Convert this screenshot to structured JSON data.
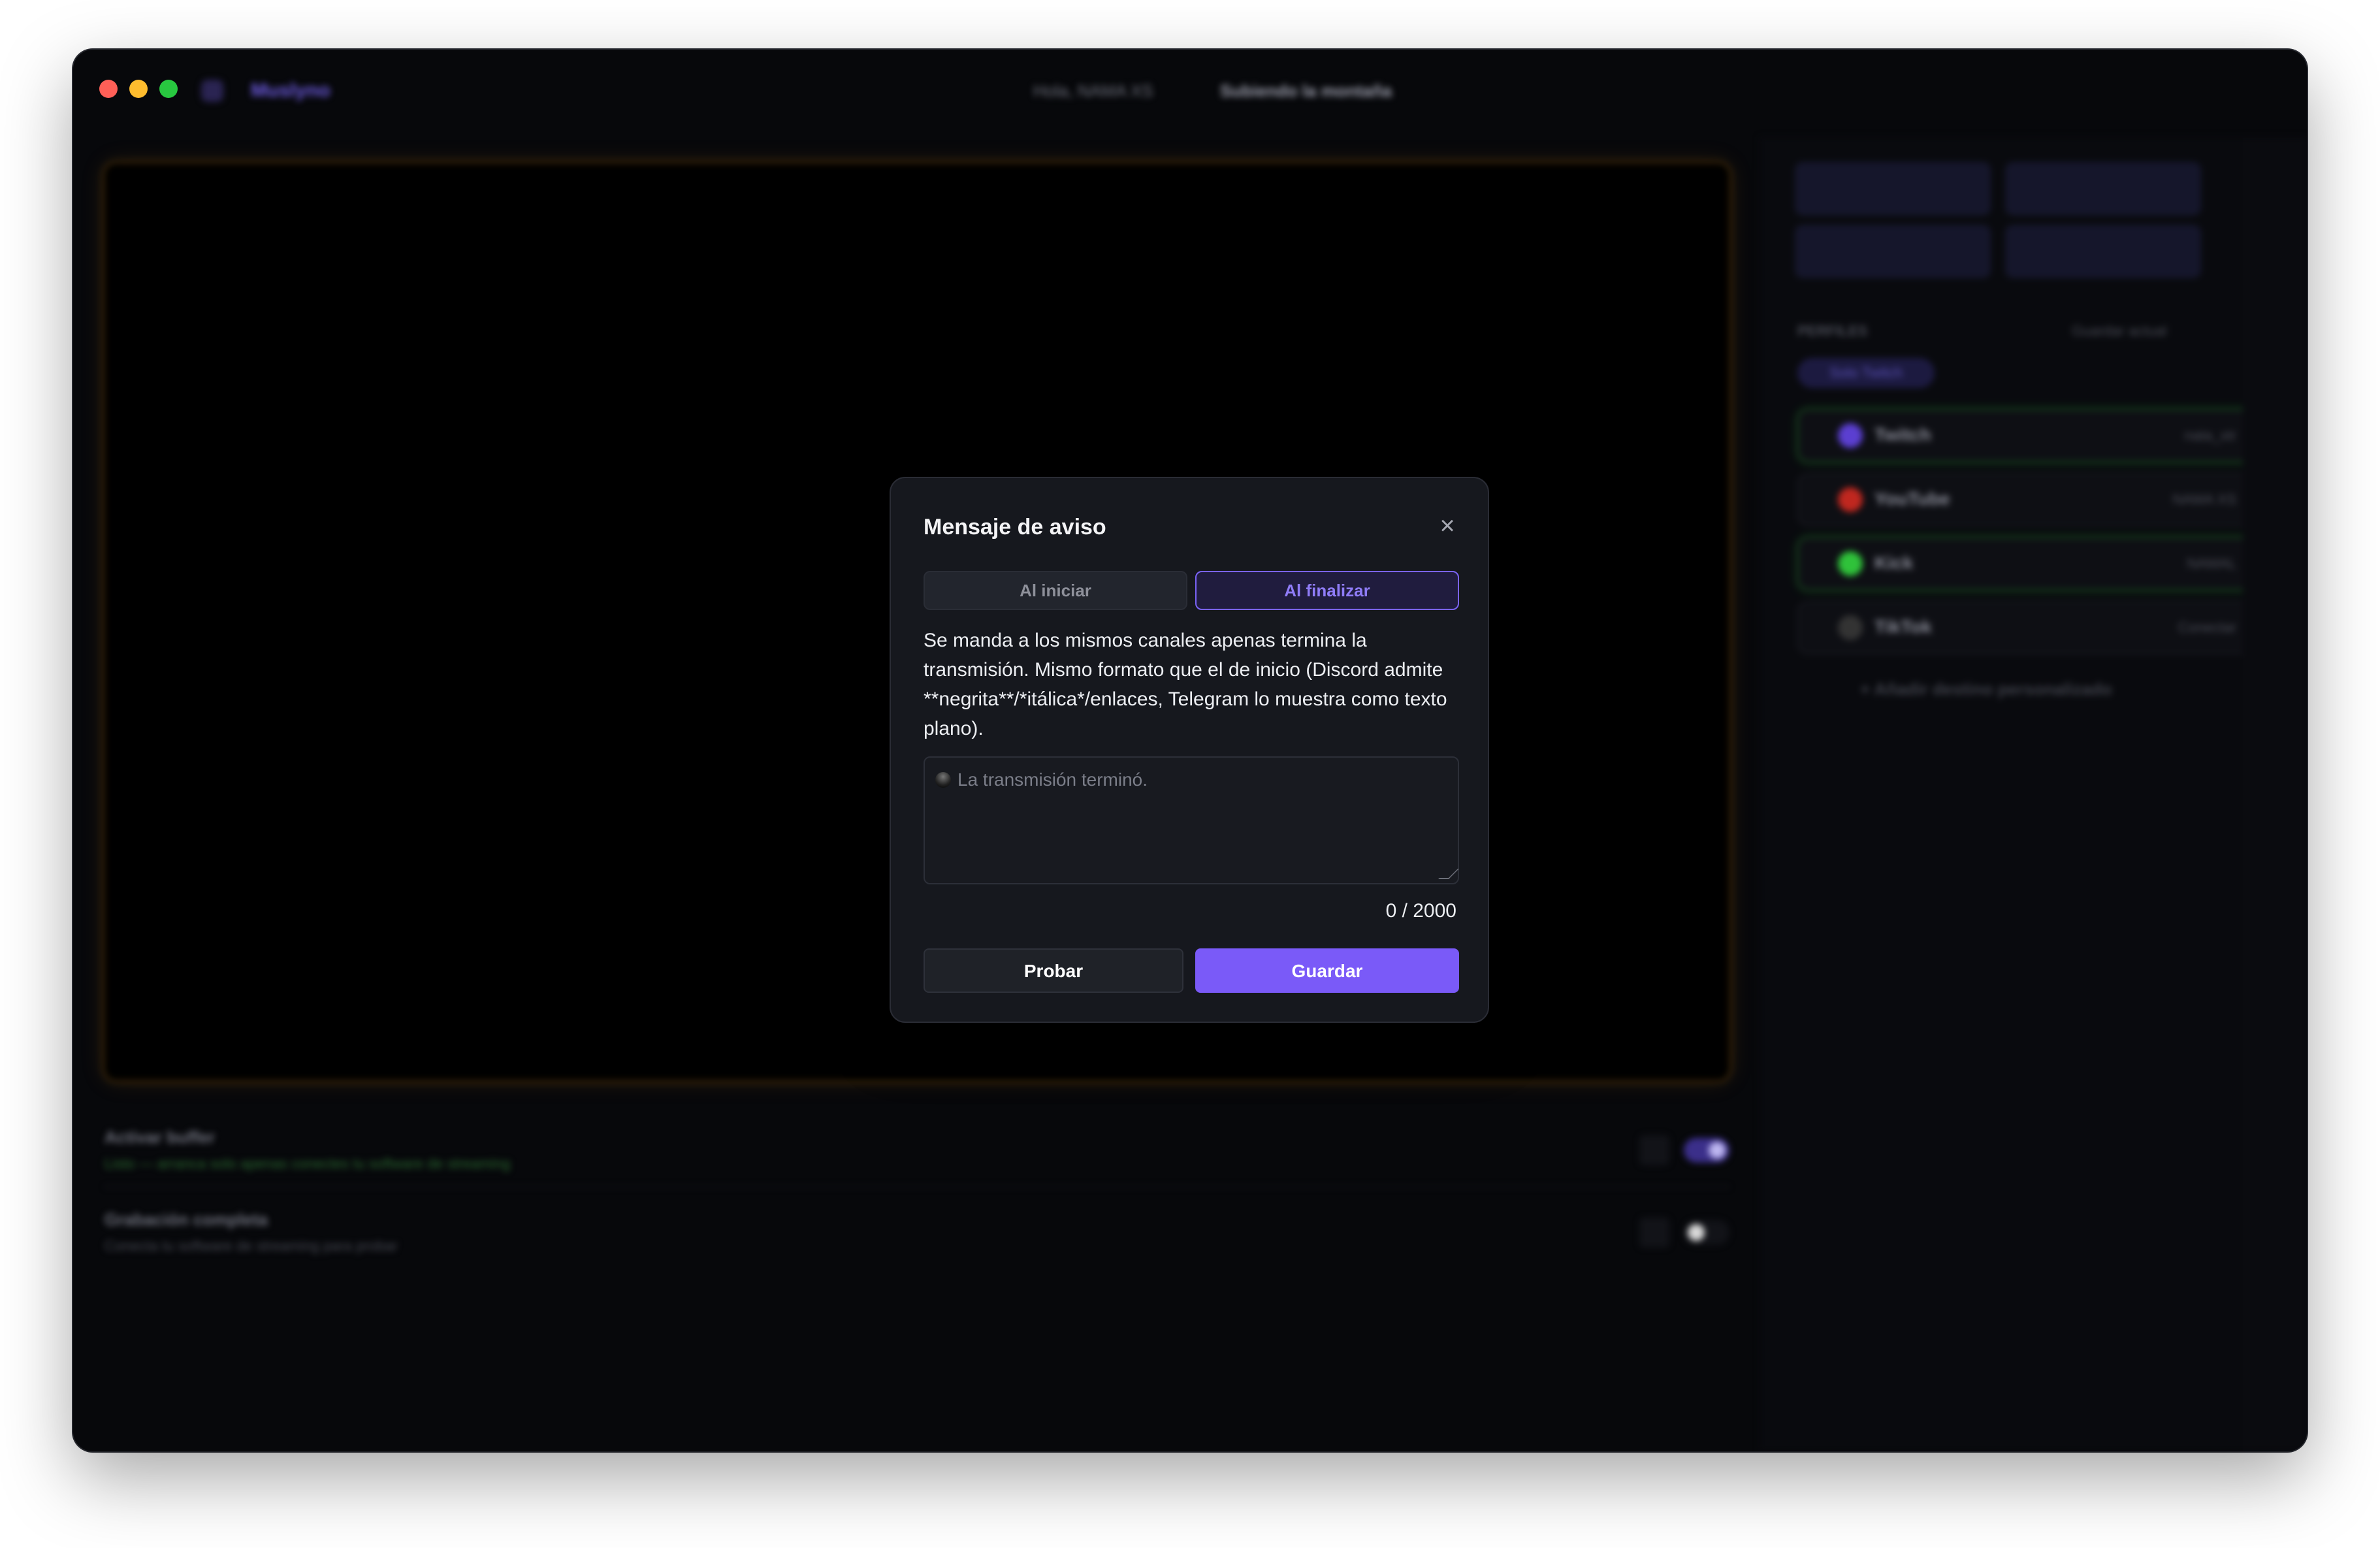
{
  "window": {
    "app_name": "Musly",
    "app_name_suffix": "no",
    "title_center": "Hola, NAMA XS",
    "title_center_bold": "Subiendo la montaña"
  },
  "sidepanel": {
    "profiles_label": "PERFILES",
    "save_current": "Guardar actual",
    "profile_pill": "Solo Twitch",
    "destinations": [
      {
        "name": "Twitch",
        "value": "nata_xtr",
        "color": "#5b3fd1",
        "live": true
      },
      {
        "name": "YouTube",
        "value": "NAMA XS",
        "color": "#c0271f",
        "live": false
      },
      {
        "name": "Kick",
        "value": "NAMAL",
        "color": "#2fc23a",
        "live": true
      },
      {
        "name": "TikTok",
        "value": "Conectar",
        "color": "#333333",
        "live": false
      }
    ],
    "add_destination": "+ Añadir destino personalizado"
  },
  "settings": {
    "buffer_title": "Activar buffer",
    "buffer_sub": "Listo — arranca solo apenas conectes tu software de streaming",
    "recording_title": "Grabación completa",
    "recording_sub": "Conecta tu software de streaming para probar"
  },
  "modal": {
    "title": "Mensaje de aviso",
    "close_icon": "close-icon",
    "tabs": [
      {
        "label": "Al iniciar",
        "active": false
      },
      {
        "label": "Al finalizar",
        "active": true
      }
    ],
    "description": "Se manda a los mismos canales apenas termina la transmisión. Mismo formato que el de inicio (Discord admite **negrita**/*itálica*/enlaces, Telegram lo muestra como texto plano).",
    "textarea": {
      "value": "",
      "placeholder": "La transmisión terminó."
    },
    "counter": "0 / 2000",
    "test_button": "Probar",
    "save_button": "Guardar"
  },
  "colors": {
    "accent": "#7a5af8",
    "modal_bg": "#16181e",
    "window_bg": "#07080b"
  }
}
